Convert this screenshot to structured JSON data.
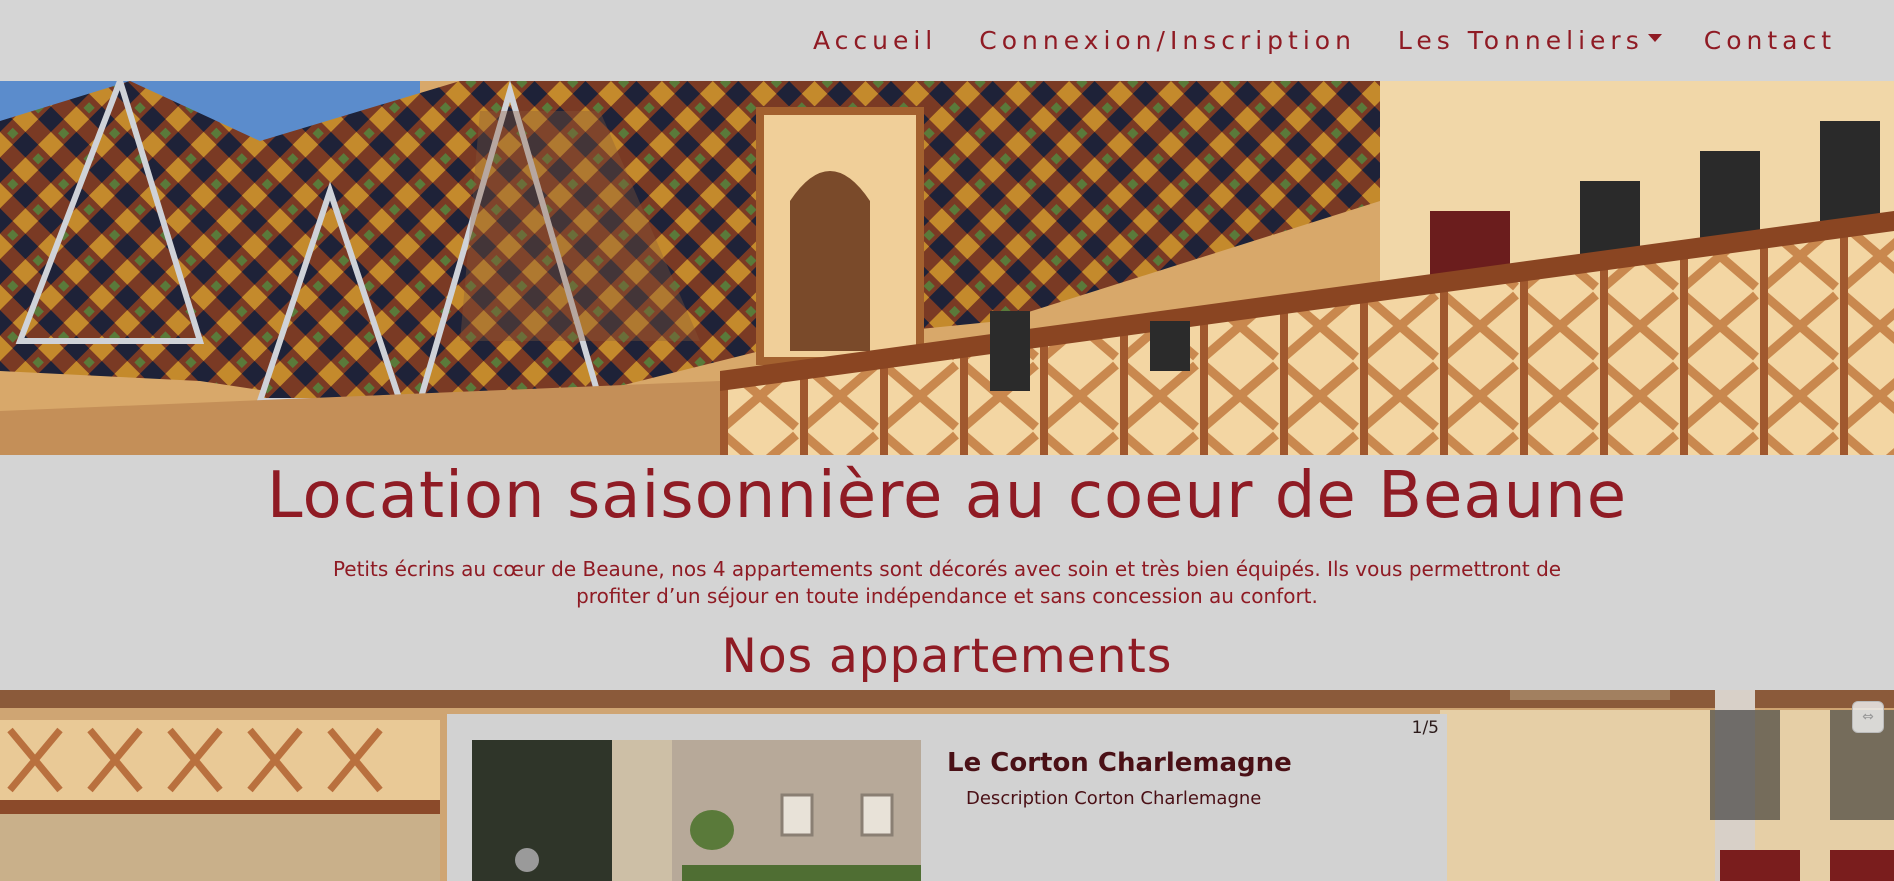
{
  "nav": {
    "items": [
      {
        "label": "Accueil"
      },
      {
        "label": "Connexion/Inscription"
      },
      {
        "label": "Les Tonneliers"
      },
      {
        "label": "Contact"
      }
    ]
  },
  "hero": {
    "image": "hospices-de-beaune-courtyard-roofs"
  },
  "main": {
    "title": "Location saisonnière au coeur de Beaune",
    "intro": "Petits écrins au cœur de Beaune, nos 4 appartements sont décorés avec soin et très bien équipés. Ils vous permettront de profiter d’un séjour en toute indépendance et sans concession au confort.",
    "section_title": "Nos appartements"
  },
  "carousel": {
    "counter": "1/5",
    "apartment": {
      "name": "Le Corton Charlemagne",
      "description": "Description Corton Charlemagne"
    },
    "nav_icon": "carousel-arrows-icon"
  },
  "colors": {
    "accent": "#8f1b24",
    "background": "#d4d4d4"
  }
}
